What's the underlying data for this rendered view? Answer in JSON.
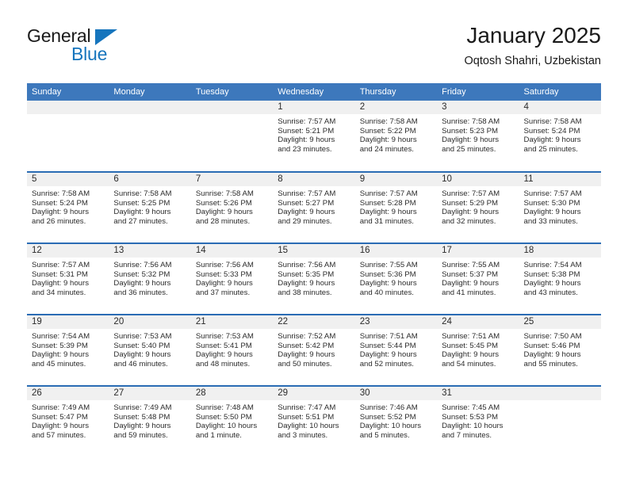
{
  "brand": {
    "name_top": "General",
    "name_bottom": "Blue",
    "triangle_color": "#1675bd"
  },
  "header": {
    "title": "January 2025",
    "subtitle": "Oqtosh Shahri, Uzbekistan"
  },
  "theme": {
    "header_blue": "#3d78bc",
    "rule_blue": "#2a6cb4",
    "daynum_band": "#f0f0f0",
    "text": "#2b2b2b"
  },
  "calendar": {
    "weekday_headers": [
      "Sunday",
      "Monday",
      "Tuesday",
      "Wednesday",
      "Thursday",
      "Friday",
      "Saturday"
    ],
    "weeks": [
      [
        {
          "day": "",
          "lines": []
        },
        {
          "day": "",
          "lines": []
        },
        {
          "day": "",
          "lines": []
        },
        {
          "day": "1",
          "lines": [
            "Sunrise: 7:57 AM",
            "Sunset: 5:21 PM",
            "Daylight: 9 hours",
            "and 23 minutes."
          ]
        },
        {
          "day": "2",
          "lines": [
            "Sunrise: 7:58 AM",
            "Sunset: 5:22 PM",
            "Daylight: 9 hours",
            "and 24 minutes."
          ]
        },
        {
          "day": "3",
          "lines": [
            "Sunrise: 7:58 AM",
            "Sunset: 5:23 PM",
            "Daylight: 9 hours",
            "and 25 minutes."
          ]
        },
        {
          "day": "4",
          "lines": [
            "Sunrise: 7:58 AM",
            "Sunset: 5:24 PM",
            "Daylight: 9 hours",
            "and 25 minutes."
          ]
        }
      ],
      [
        {
          "day": "5",
          "lines": [
            "Sunrise: 7:58 AM",
            "Sunset: 5:24 PM",
            "Daylight: 9 hours",
            "and 26 minutes."
          ]
        },
        {
          "day": "6",
          "lines": [
            "Sunrise: 7:58 AM",
            "Sunset: 5:25 PM",
            "Daylight: 9 hours",
            "and 27 minutes."
          ]
        },
        {
          "day": "7",
          "lines": [
            "Sunrise: 7:58 AM",
            "Sunset: 5:26 PM",
            "Daylight: 9 hours",
            "and 28 minutes."
          ]
        },
        {
          "day": "8",
          "lines": [
            "Sunrise: 7:57 AM",
            "Sunset: 5:27 PM",
            "Daylight: 9 hours",
            "and 29 minutes."
          ]
        },
        {
          "day": "9",
          "lines": [
            "Sunrise: 7:57 AM",
            "Sunset: 5:28 PM",
            "Daylight: 9 hours",
            "and 31 minutes."
          ]
        },
        {
          "day": "10",
          "lines": [
            "Sunrise: 7:57 AM",
            "Sunset: 5:29 PM",
            "Daylight: 9 hours",
            "and 32 minutes."
          ]
        },
        {
          "day": "11",
          "lines": [
            "Sunrise: 7:57 AM",
            "Sunset: 5:30 PM",
            "Daylight: 9 hours",
            "and 33 minutes."
          ]
        }
      ],
      [
        {
          "day": "12",
          "lines": [
            "Sunrise: 7:57 AM",
            "Sunset: 5:31 PM",
            "Daylight: 9 hours",
            "and 34 minutes."
          ]
        },
        {
          "day": "13",
          "lines": [
            "Sunrise: 7:56 AM",
            "Sunset: 5:32 PM",
            "Daylight: 9 hours",
            "and 36 minutes."
          ]
        },
        {
          "day": "14",
          "lines": [
            "Sunrise: 7:56 AM",
            "Sunset: 5:33 PM",
            "Daylight: 9 hours",
            "and 37 minutes."
          ]
        },
        {
          "day": "15",
          "lines": [
            "Sunrise: 7:56 AM",
            "Sunset: 5:35 PM",
            "Daylight: 9 hours",
            "and 38 minutes."
          ]
        },
        {
          "day": "16",
          "lines": [
            "Sunrise: 7:55 AM",
            "Sunset: 5:36 PM",
            "Daylight: 9 hours",
            "and 40 minutes."
          ]
        },
        {
          "day": "17",
          "lines": [
            "Sunrise: 7:55 AM",
            "Sunset: 5:37 PM",
            "Daylight: 9 hours",
            "and 41 minutes."
          ]
        },
        {
          "day": "18",
          "lines": [
            "Sunrise: 7:54 AM",
            "Sunset: 5:38 PM",
            "Daylight: 9 hours",
            "and 43 minutes."
          ]
        }
      ],
      [
        {
          "day": "19",
          "lines": [
            "Sunrise: 7:54 AM",
            "Sunset: 5:39 PM",
            "Daylight: 9 hours",
            "and 45 minutes."
          ]
        },
        {
          "day": "20",
          "lines": [
            "Sunrise: 7:53 AM",
            "Sunset: 5:40 PM",
            "Daylight: 9 hours",
            "and 46 minutes."
          ]
        },
        {
          "day": "21",
          "lines": [
            "Sunrise: 7:53 AM",
            "Sunset: 5:41 PM",
            "Daylight: 9 hours",
            "and 48 minutes."
          ]
        },
        {
          "day": "22",
          "lines": [
            "Sunrise: 7:52 AM",
            "Sunset: 5:42 PM",
            "Daylight: 9 hours",
            "and 50 minutes."
          ]
        },
        {
          "day": "23",
          "lines": [
            "Sunrise: 7:51 AM",
            "Sunset: 5:44 PM",
            "Daylight: 9 hours",
            "and 52 minutes."
          ]
        },
        {
          "day": "24",
          "lines": [
            "Sunrise: 7:51 AM",
            "Sunset: 5:45 PM",
            "Daylight: 9 hours",
            "and 54 minutes."
          ]
        },
        {
          "day": "25",
          "lines": [
            "Sunrise: 7:50 AM",
            "Sunset: 5:46 PM",
            "Daylight: 9 hours",
            "and 55 minutes."
          ]
        }
      ],
      [
        {
          "day": "26",
          "lines": [
            "Sunrise: 7:49 AM",
            "Sunset: 5:47 PM",
            "Daylight: 9 hours",
            "and 57 minutes."
          ]
        },
        {
          "day": "27",
          "lines": [
            "Sunrise: 7:49 AM",
            "Sunset: 5:48 PM",
            "Daylight: 9 hours",
            "and 59 minutes."
          ]
        },
        {
          "day": "28",
          "lines": [
            "Sunrise: 7:48 AM",
            "Sunset: 5:50 PM",
            "Daylight: 10 hours",
            "and 1 minute."
          ]
        },
        {
          "day": "29",
          "lines": [
            "Sunrise: 7:47 AM",
            "Sunset: 5:51 PM",
            "Daylight: 10 hours",
            "and 3 minutes."
          ]
        },
        {
          "day": "30",
          "lines": [
            "Sunrise: 7:46 AM",
            "Sunset: 5:52 PM",
            "Daylight: 10 hours",
            "and 5 minutes."
          ]
        },
        {
          "day": "31",
          "lines": [
            "Sunrise: 7:45 AM",
            "Sunset: 5:53 PM",
            "Daylight: 10 hours",
            "and 7 minutes."
          ]
        },
        {
          "day": "",
          "lines": []
        }
      ]
    ]
  }
}
